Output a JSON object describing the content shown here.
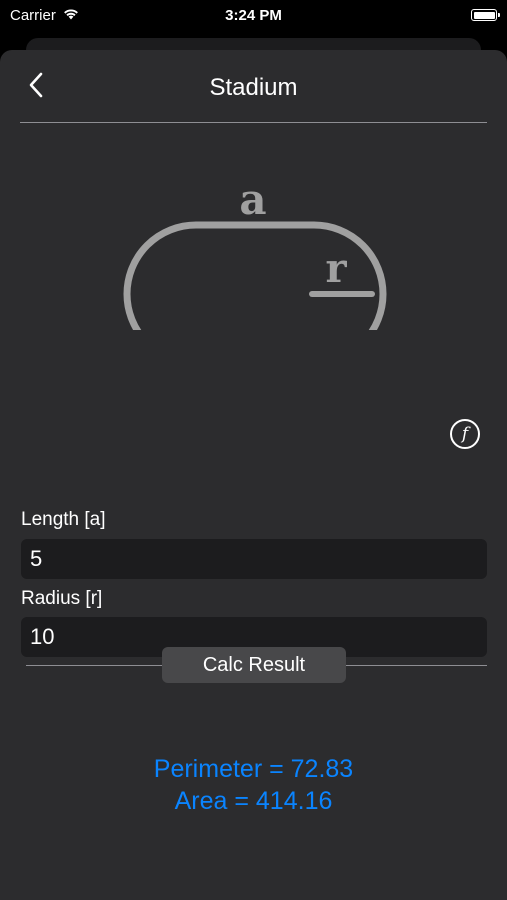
{
  "status_bar": {
    "carrier": "Carrier",
    "time": "3:24 PM"
  },
  "nav": {
    "title": "Stadium",
    "back_icon": "chevron-left-icon"
  },
  "diagram": {
    "label_a": "a",
    "label_r": "r"
  },
  "formula_icon": "function-icon",
  "formula_glyph": "f",
  "fields": [
    {
      "label": "Length [a]",
      "value": "5"
    },
    {
      "label": "Radius [r]",
      "value": "10"
    }
  ],
  "calc_button": "Calc Result",
  "results": {
    "perimeter": "Perimeter = 72.83",
    "area": "Area = 414.16"
  },
  "colors": {
    "accent": "#0a84ff",
    "sheet_bg": "#2c2c2e",
    "input_bg": "#1c1c1e",
    "shape_stroke": "#a0a0a0"
  }
}
